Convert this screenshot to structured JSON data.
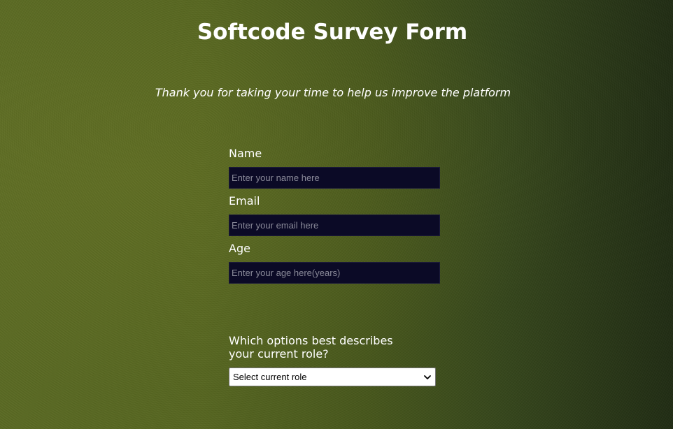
{
  "header": {
    "title": "Softcode Survey Form",
    "description": "Thank you for taking your time to help us improve the platform"
  },
  "form": {
    "name": {
      "label": "Name",
      "placeholder": "Enter your name here",
      "value": ""
    },
    "email": {
      "label": "Email",
      "placeholder": "Enter your email here",
      "value": ""
    },
    "age": {
      "label": "Age",
      "placeholder": "Enter your age here(years)",
      "value": ""
    },
    "role": {
      "question": "Which options best describes your current role?",
      "selected": "Select current role",
      "icon": "chevron-down-icon"
    }
  },
  "colors": {
    "background_start": "#5a6a22",
    "background_end": "#1f2b12",
    "input_background": "#0b0a26",
    "text": "#ffffff"
  }
}
